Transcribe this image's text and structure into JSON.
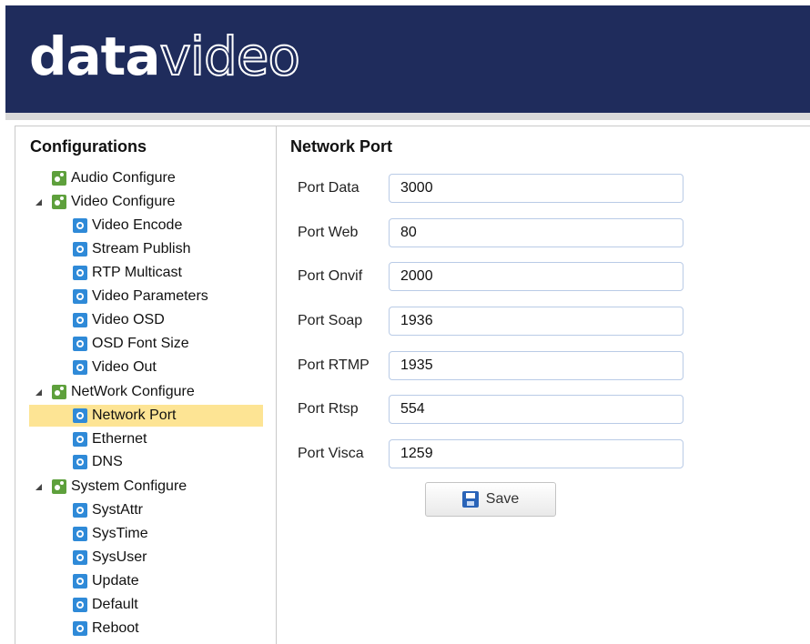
{
  "header": {
    "logo_bold": "data",
    "logo_outline": "video"
  },
  "sidebar": {
    "title": "Configurations",
    "items": [
      {
        "label": "Audio Configure",
        "icon": "group-gear-icon"
      },
      {
        "label": "Video Configure",
        "icon": "group-gear-icon"
      },
      {
        "label": "Video Encode",
        "icon": "config-gear-icon"
      },
      {
        "label": "Stream Publish",
        "icon": "config-gear-icon"
      },
      {
        "label": "RTP Multicast",
        "icon": "config-gear-icon"
      },
      {
        "label": "Video Parameters",
        "icon": "config-gear-icon"
      },
      {
        "label": "Video OSD",
        "icon": "config-gear-icon"
      },
      {
        "label": "OSD Font Size",
        "icon": "config-gear-icon"
      },
      {
        "label": "Video Out",
        "icon": "config-gear-icon"
      },
      {
        "label": "NetWork Configure",
        "icon": "group-gear-icon"
      },
      {
        "label": "Network Port",
        "icon": "config-gear-icon",
        "selected": true
      },
      {
        "label": "Ethernet",
        "icon": "config-gear-icon"
      },
      {
        "label": "DNS",
        "icon": "config-gear-icon"
      },
      {
        "label": "System Configure",
        "icon": "group-gear-icon"
      },
      {
        "label": "SystAttr",
        "icon": "config-gear-icon"
      },
      {
        "label": "SysTime",
        "icon": "config-gear-icon"
      },
      {
        "label": "SysUser",
        "icon": "config-gear-icon"
      },
      {
        "label": "Update",
        "icon": "config-gear-icon"
      },
      {
        "label": "Default",
        "icon": "config-gear-icon"
      },
      {
        "label": "Reboot",
        "icon": "config-gear-icon"
      }
    ]
  },
  "main": {
    "title": "Network Port",
    "fields": [
      {
        "label": "Port Data",
        "value": "3000"
      },
      {
        "label": "Port Web",
        "value": "80"
      },
      {
        "label": "Port Onvif",
        "value": "2000"
      },
      {
        "label": "Port Soap",
        "value": "1936"
      },
      {
        "label": "Port RTMP",
        "value": "1935"
      },
      {
        "label": "Port Rtsp",
        "value": "554"
      },
      {
        "label": "Port Visca",
        "value": "1259"
      }
    ],
    "save_label": "Save",
    "save_icon": "floppy-disk-icon"
  },
  "colors": {
    "header_bg": "#1f2c5c",
    "selected_bg": "#fde494",
    "group_icon": "#5ea03c",
    "config_icon": "#2f8ad8"
  }
}
